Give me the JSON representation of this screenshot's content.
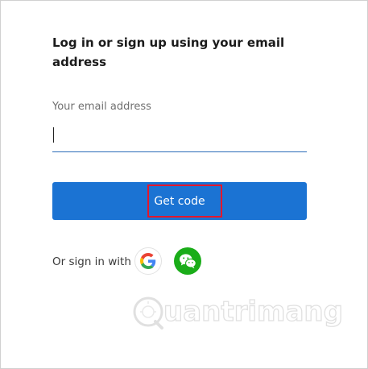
{
  "login": {
    "title": "Log in or sign up using your email address",
    "email_label": "Your email address",
    "email_value": "",
    "get_code_label": "Get code",
    "social_label": "Or sign in with",
    "social_providers": [
      "google-icon",
      "wechat-icon"
    ]
  },
  "watermark": {
    "text": "uantrimang"
  },
  "colors": {
    "primary": "#1b73d3",
    "highlight": "#e3172c",
    "wechat": "#1aad19",
    "input_underline": "#2b6cb8"
  }
}
